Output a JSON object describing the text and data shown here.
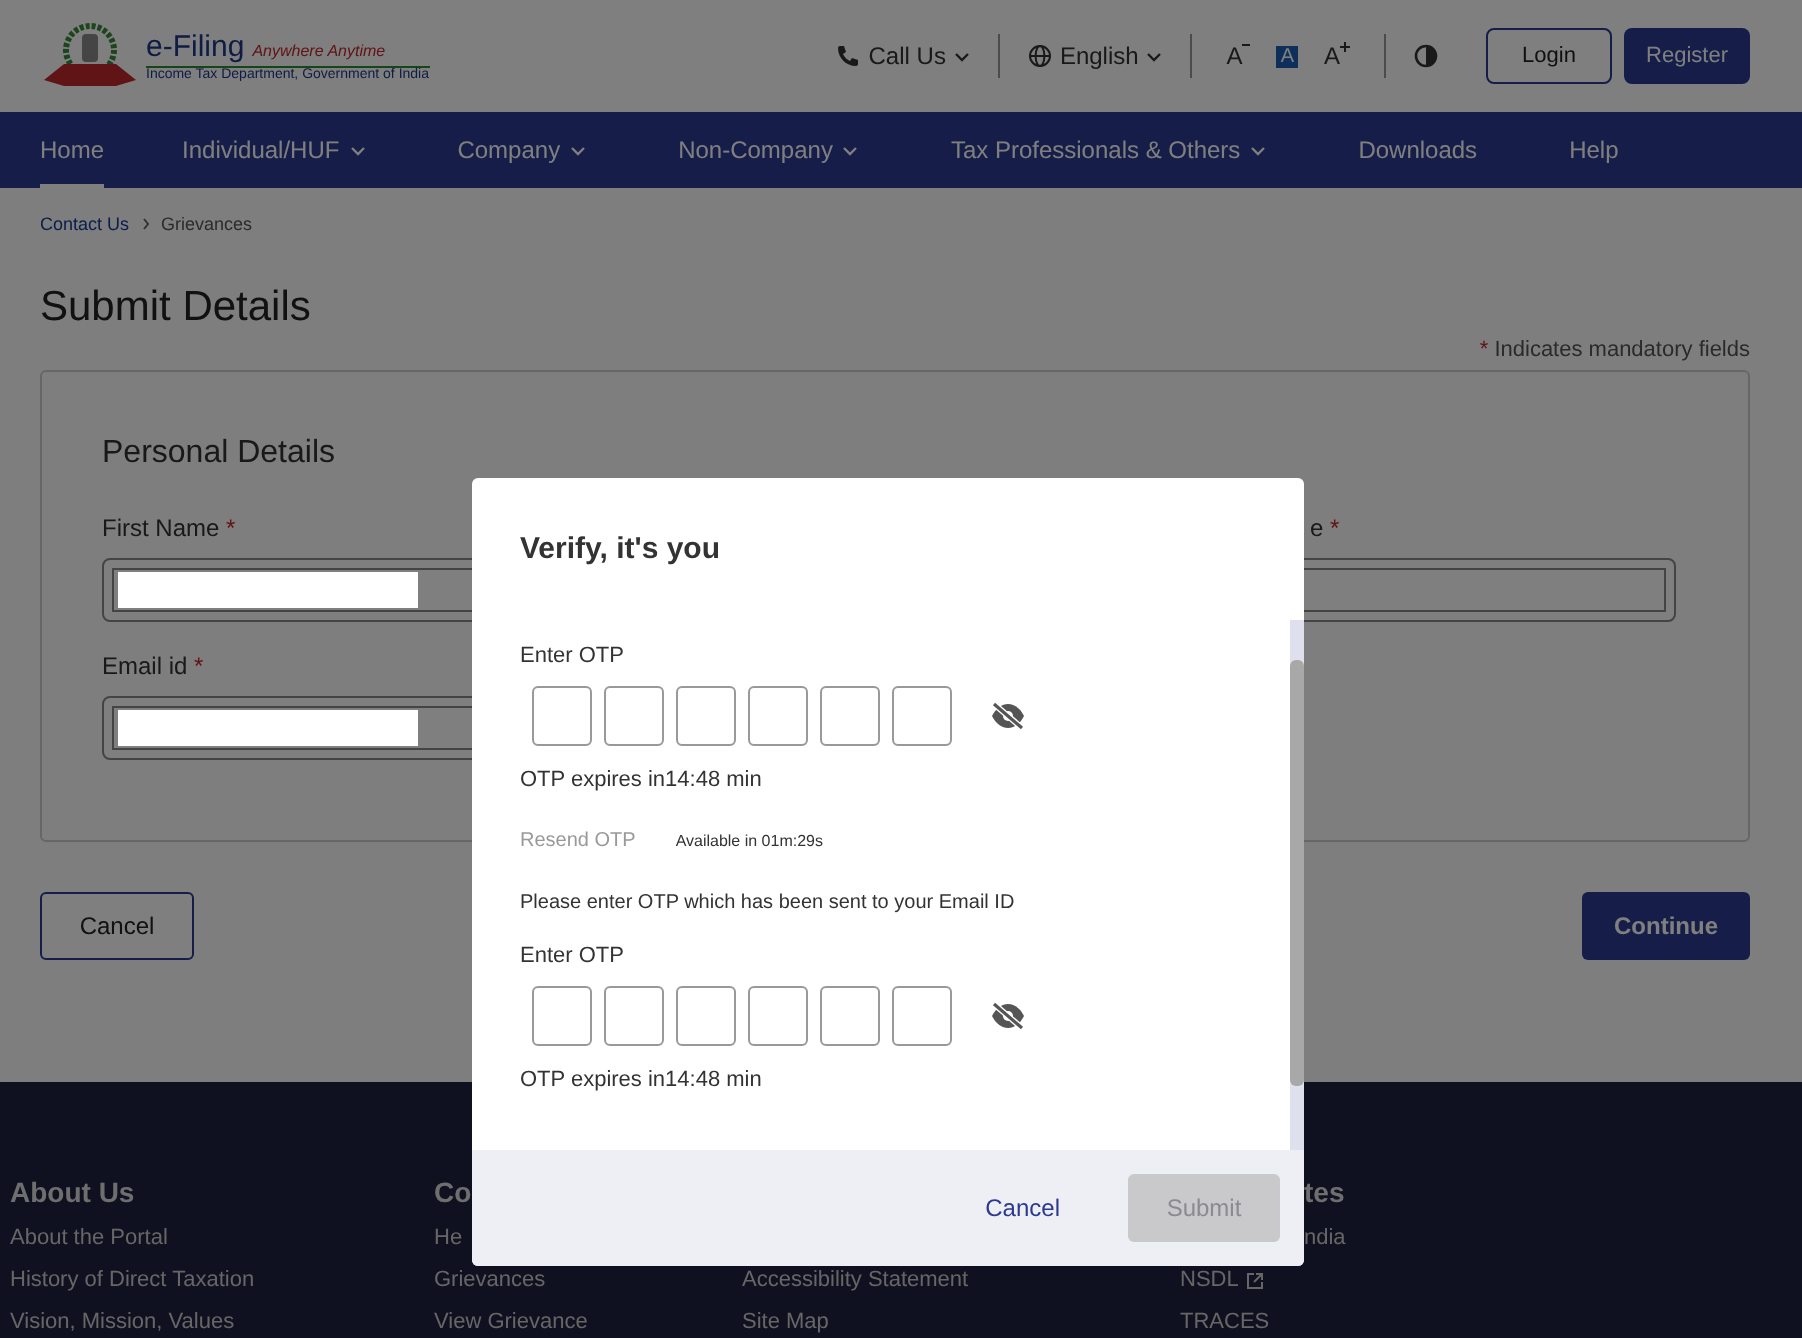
{
  "header": {
    "logo": {
      "title": "e-Filing",
      "tagline": "Anywhere Anytime",
      "subtitle": "Income Tax Department, Government of India"
    },
    "call_us": "Call Us",
    "language": "English",
    "font_sizes": [
      {
        "label": "A",
        "kind": "decrease",
        "selected": false
      },
      {
        "label": "A",
        "kind": "default",
        "selected": true
      },
      {
        "label": "A",
        "kind": "increase",
        "selected": false
      }
    ],
    "login": "Login",
    "register": "Register"
  },
  "nav": [
    {
      "label": "Home",
      "dropdown": false,
      "selected": true
    },
    {
      "label": "Individual/HUF",
      "dropdown": true,
      "selected": false
    },
    {
      "label": "Company",
      "dropdown": true,
      "selected": false
    },
    {
      "label": "Non-Company",
      "dropdown": true,
      "selected": false
    },
    {
      "label": "Tax Professionals & Others",
      "dropdown": true,
      "selected": false
    },
    {
      "label": "Downloads",
      "dropdown": false,
      "selected": false
    },
    {
      "label": "Help",
      "dropdown": false,
      "selected": false
    }
  ],
  "breadcrumb": [
    "Contact Us",
    "Grievances"
  ],
  "page_title": "Submit Details",
  "required_mark": "*",
  "mandatory_note": "Indicates mandatory fields",
  "form": {
    "section_title": "Personal Details",
    "rows": [
      {
        "left": {
          "label": "First Name",
          "required": true,
          "masked": true
        },
        "right": {
          "label": "e",
          "required": true,
          "masked": false
        }
      },
      {
        "left": {
          "label": "Email id",
          "required": true,
          "masked": true
        }
      }
    ]
  },
  "buttons": {
    "cancel": "Cancel",
    "continue": "Continue"
  },
  "footer": [
    {
      "heading": "About Us",
      "links": [
        "About the Portal",
        "History of Direct Taxation",
        "Vision, Mission, Values"
      ]
    },
    {
      "heading": "Co",
      "links": [
        "He",
        "Grievances",
        "View Grievance"
      ]
    },
    {
      "links": [
        "Accessibility Statement",
        "Site Map"
      ]
    },
    {
      "heading": "tes",
      "links": [
        "ndia",
        "NSDL",
        "TRACES"
      ],
      "external": [
        false,
        true,
        false
      ]
    }
  ],
  "modal": {
    "title": "Verify, it's you",
    "body": [
      {
        "kind": "otp",
        "label": "Enter OTP",
        "boxes": [
          {
            "focused": false
          },
          {
            "focused": false
          },
          {
            "focused": false
          },
          {
            "focused": false
          },
          {
            "focused": false
          },
          {
            "focused": false
          }
        ],
        "hidden": true,
        "expiry": "OTP expires in14:48 min"
      },
      {
        "kind": "resend",
        "label": "Resend OTP",
        "disabled": true,
        "note": "Available in 01m:29s"
      },
      {
        "kind": "text",
        "text": "Please enter OTP which has been sent to your Email ID"
      },
      {
        "kind": "otp",
        "label": "Enter OTP",
        "boxes": [
          {
            "focused": false
          },
          {
            "focused": false
          },
          {
            "focused": false
          },
          {
            "focused": false
          },
          {
            "focused": false
          },
          {
            "focused": false
          }
        ],
        "hidden": true,
        "expiry": "OTP expires in14:48 min"
      }
    ],
    "cancel": "Cancel",
    "submit": {
      "label": "Submit",
      "disabled": true
    }
  }
}
